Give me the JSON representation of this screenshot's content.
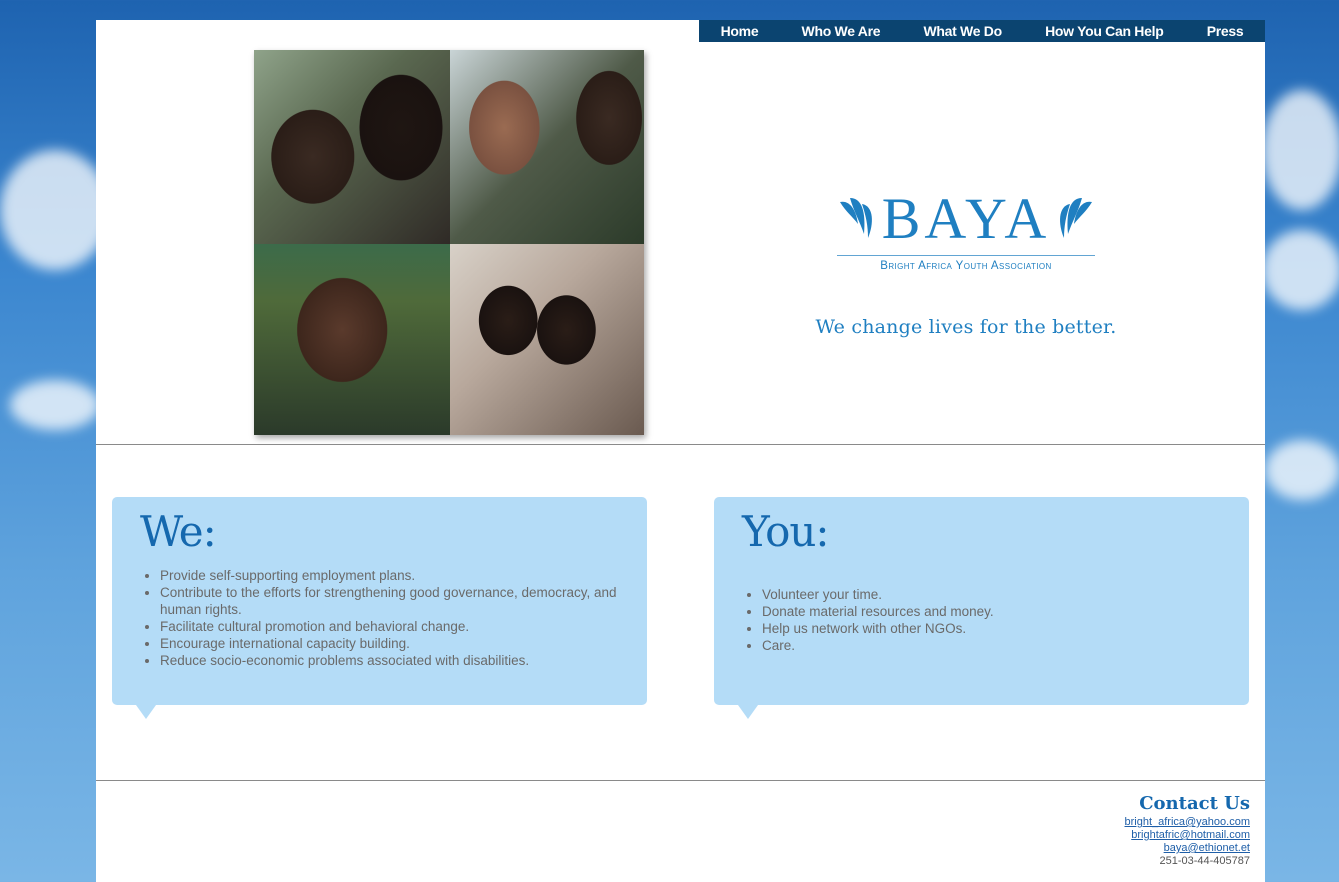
{
  "nav": {
    "items": [
      "Home",
      "Who We Are",
      "What We Do",
      "How You Can Help",
      "Press"
    ]
  },
  "logo": {
    "name": "BAYA",
    "subtitle": "Bright Africa Youth Association"
  },
  "tagline": "We change lives for the better.",
  "we_box": {
    "title": "We:",
    "items": [
      "Provide self-supporting employment plans.",
      "Contribute to the efforts for strengthening good governance, democracy, and human rights.",
      "Facilitate cultural promotion and behavioral change.",
      "Encourage international capacity building.",
      "Reduce socio-economic problems associated with disabilities."
    ]
  },
  "you_box": {
    "title": "You:",
    "items": [
      "Volunteer your time.",
      "Donate material resources and money.",
      "Help us network with other NGOs.",
      "Care."
    ]
  },
  "contact": {
    "title": "Contact Us",
    "emails": [
      "bright_africa@yahoo.com",
      "brightafric@hotmail.com",
      "baya@ethionet.et"
    ],
    "phone": "251-03-44-405787"
  },
  "colors": {
    "nav_bg": "#0b4470",
    "brand_blue": "#1f7fc1",
    "bubble_bg": "#b4dcf7"
  }
}
